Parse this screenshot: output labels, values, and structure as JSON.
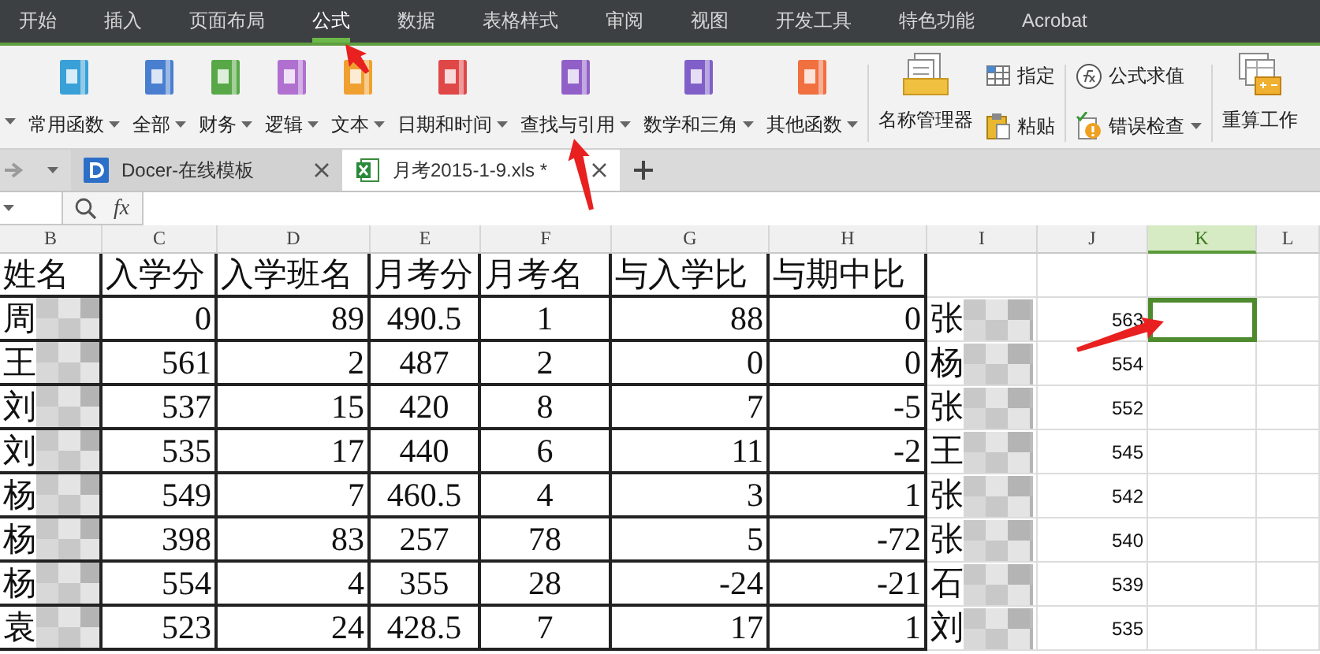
{
  "menu_tabs": [
    {
      "label": "开始",
      "selected": false
    },
    {
      "label": "插入",
      "selected": false
    },
    {
      "label": "页面布局",
      "selected": false
    },
    {
      "label": "公式",
      "selected": true
    },
    {
      "label": "数据",
      "selected": false
    },
    {
      "label": "表格样式",
      "selected": false
    },
    {
      "label": "审阅",
      "selected": false
    },
    {
      "label": "视图",
      "selected": false
    },
    {
      "label": "开发工具",
      "selected": false
    },
    {
      "label": "特色功能",
      "selected": false
    },
    {
      "label": "Acrobat",
      "selected": false
    }
  ],
  "ribbon": {
    "function_buttons": [
      {
        "label": "常用函数",
        "color": "#3aa0d8",
        "dropdown": true
      },
      {
        "label": "全部",
        "color": "#4a7fd0",
        "dropdown": true
      },
      {
        "label": "财务",
        "color": "#58a848",
        "dropdown": true
      },
      {
        "label": "逻辑",
        "color": "#b070d0",
        "dropdown": true
      },
      {
        "label": "文本",
        "color": "#f0a030",
        "dropdown": true
      },
      {
        "label": "日期和时间",
        "color": "#e04848",
        "dropdown": true
      },
      {
        "label": "查找与引用",
        "color": "#9060c8",
        "dropdown": true
      },
      {
        "label": "数学和三角",
        "color": "#8060c8",
        "dropdown": true
      },
      {
        "label": "其他函数",
        "color": "#f07040",
        "dropdown": true
      }
    ],
    "name_manager": {
      "label": "名称管理器"
    },
    "small_buttons": [
      {
        "label": "指定",
        "kind": "define"
      },
      {
        "label": "粘贴",
        "kind": "paste"
      }
    ],
    "audit_buttons": [
      {
        "label": "公式求值",
        "kind": "evaluate",
        "dropdown": false
      },
      {
        "label": "错误检查",
        "kind": "check",
        "dropdown": true
      }
    ],
    "recalc": {
      "label": "重算工作"
    }
  },
  "doc_tabs": [
    {
      "label": "Docer-在线模板",
      "kind": "docer",
      "selected": false
    },
    {
      "label": "月考2015-1-9.xls *",
      "kind": "sheet",
      "selected": true
    }
  ],
  "formula_bar": {
    "fx_label": "fx"
  },
  "columns": [
    {
      "label": "B",
      "selected": false
    },
    {
      "label": "C",
      "selected": false
    },
    {
      "label": "D",
      "selected": false
    },
    {
      "label": "E",
      "selected": false
    },
    {
      "label": "F",
      "selected": false
    },
    {
      "label": "G",
      "selected": false
    },
    {
      "label": "H",
      "selected": false
    },
    {
      "label": "I",
      "selected": false
    },
    {
      "label": "J",
      "selected": false
    },
    {
      "label": "K",
      "selected": true
    },
    {
      "label": "L",
      "selected": false
    }
  ],
  "header_cells": [
    "姓名",
    "入学分",
    "入学班名",
    "月考分",
    "月考名",
    "与入学比",
    "与期中比"
  ],
  "rows": [
    {
      "cells": [
        "周",
        "0",
        "89",
        "490.5",
        "1",
        "88",
        "0",
        "张",
        "563"
      ],
      "k_selected": true
    },
    {
      "cells": [
        "王",
        "561",
        "2",
        "487",
        "2",
        "0",
        "0",
        "杨",
        "554"
      ],
      "k_selected": false
    },
    {
      "cells": [
        "刘",
        "537",
        "15",
        "420",
        "8",
        "7",
        "-5",
        "张",
        "552"
      ],
      "k_selected": false
    },
    {
      "cells": [
        "刘",
        "535",
        "17",
        "440",
        "6",
        "11",
        "-2",
        "王",
        "545"
      ],
      "k_selected": false
    },
    {
      "cells": [
        "杨",
        "549",
        "7",
        "460.5",
        "4",
        "3",
        "1",
        "张",
        "542"
      ],
      "k_selected": false
    },
    {
      "cells": [
        "杨",
        "398",
        "83",
        "257",
        "78",
        "5",
        "-72",
        "张",
        "540"
      ],
      "k_selected": false
    },
    {
      "cells": [
        "杨",
        "554",
        "4",
        "355",
        "28",
        "-24",
        "-21",
        "石",
        "539"
      ],
      "k_selected": false
    },
    {
      "cells": [
        "袁",
        "523",
        "24",
        "428.5",
        "7",
        "17",
        "1",
        "刘",
        "535"
      ],
      "k_selected": false
    }
  ]
}
